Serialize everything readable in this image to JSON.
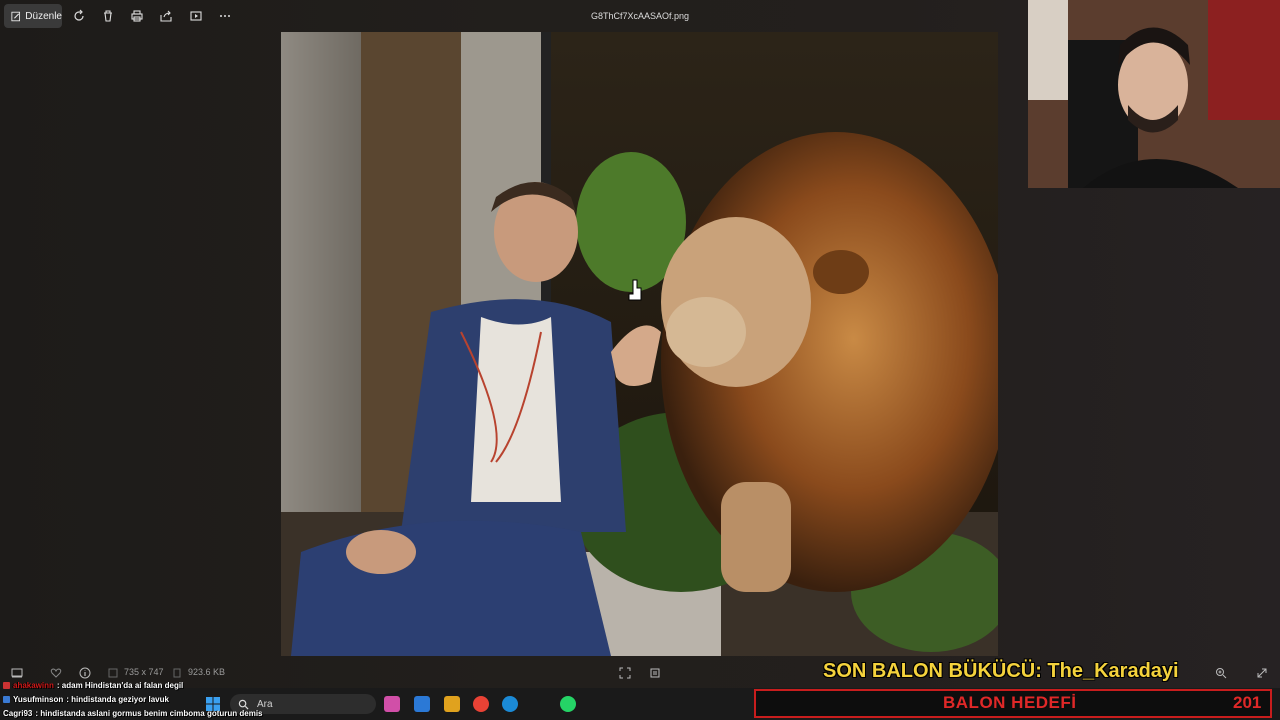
{
  "toolbar": {
    "edit_label": "Düzenle",
    "icons": [
      "edit-icon",
      "rotate-icon",
      "delete-icon",
      "print-icon",
      "share-icon",
      "slideshow-icon",
      "more-icon"
    ]
  },
  "file": {
    "name": "G8ThCf7XcAASAOf.png",
    "dimensions": "735 x 747",
    "size": "923.6 KB"
  },
  "overlay": {
    "banner": "SON BALON BÜKÜCÜ: The_Karadayi",
    "balloon_goal_label": "BALON HEDEFİ",
    "balloon_goal_count": "201"
  },
  "taskbar": {
    "search_placeholder": "Ara"
  },
  "chat": [
    {
      "user": "ahakawinn",
      "message": ": adam Hindistan'da ai falan degil",
      "color": "#d01919"
    },
    {
      "user": "Yusufminson",
      "message": ": hindistanda geziyor lavuk",
      "color": "#ffffff"
    },
    {
      "user": "Cagri93",
      "message": ": hindistanda aslani gormus benim cimboma goturun demis",
      "color": "#ffffff"
    }
  ],
  "colors": {
    "banner": "#f4d23c",
    "balloon": "#e02828",
    "viewer_bg": "#1f1c1a"
  }
}
